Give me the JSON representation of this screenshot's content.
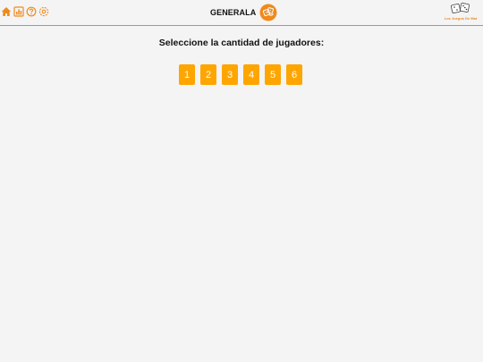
{
  "header": {
    "title": "GENERALA",
    "brand": "Los Juegos De Mat",
    "icons": [
      "home-icon",
      "stats-icon",
      "help-icon",
      "settings-icon"
    ]
  },
  "main": {
    "prompt": "Seleccione la cantidad de jugadores:",
    "player_options": [
      "1",
      "2",
      "3",
      "4",
      "5",
      "6"
    ]
  },
  "colors": {
    "accent": "#f08a1c",
    "button": "#ffa500",
    "background": "#f4f4f4"
  }
}
